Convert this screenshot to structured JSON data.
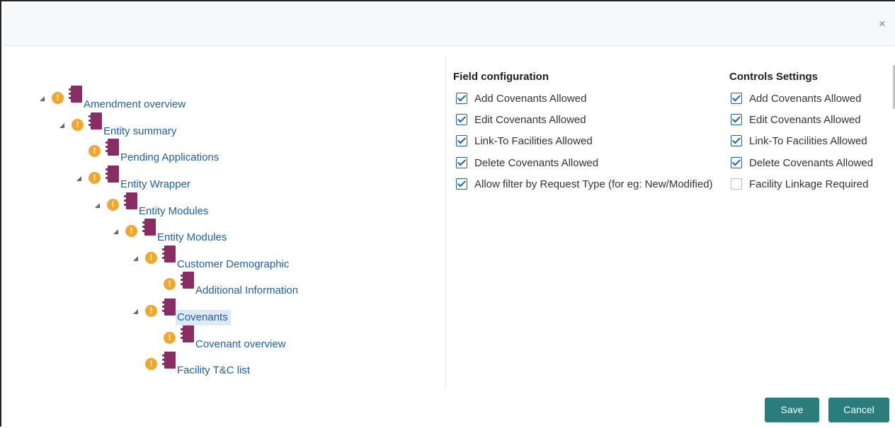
{
  "header": {
    "close_label": "×"
  },
  "tree": [
    {
      "label": "Amendment overview",
      "caret": true,
      "selected": false
    },
    {
      "label": "Entity summary",
      "caret": true,
      "selected": false
    },
    {
      "label": "Pending Applications",
      "caret": false,
      "selected": false
    },
    {
      "label": "Entity Wrapper",
      "caret": true,
      "selected": false
    },
    {
      "label": "Entity Modules",
      "caret": true,
      "selected": false
    },
    {
      "label": "Entity Modules",
      "caret": true,
      "selected": false
    },
    {
      "label": "Customer Demographic",
      "caret": true,
      "selected": false
    },
    {
      "label": "Additional Information",
      "caret": false,
      "selected": false
    },
    {
      "label": "Covenants",
      "caret": true,
      "selected": true
    },
    {
      "label": "Covenant overview",
      "caret": false,
      "selected": false
    },
    {
      "label": "Facility T&C list",
      "caret": false,
      "selected": false
    }
  ],
  "field_configuration": {
    "title": "Field configuration",
    "items": [
      {
        "label": "Add Covenants Allowed",
        "checked": true
      },
      {
        "label": "Edit Covenants Allowed",
        "checked": true
      },
      {
        "label": "Link-To Facilities Allowed",
        "checked": true
      },
      {
        "label": "Delete Covenants Allowed",
        "checked": true
      },
      {
        "label": "Allow filter by Request Type (for eg: New/Modified)",
        "checked": true
      }
    ]
  },
  "controls_settings": {
    "title": "Controls Settings",
    "items": [
      {
        "label": "Add Covenants Allowed",
        "checked": true
      },
      {
        "label": "Edit Covenants Allowed",
        "checked": true
      },
      {
        "label": "Link-To Facilities Allowed",
        "checked": true
      },
      {
        "label": "Delete Covenants Allowed",
        "checked": true
      },
      {
        "label": "Facility Linkage Required",
        "checked": false
      }
    ]
  },
  "footer": {
    "save_label": "Save",
    "cancel_label": "Cancel"
  },
  "colors": {
    "accent_button": "#2a7d7b",
    "link": "#1f5f9f",
    "book_icon": "#8a2c64",
    "alert_icon": "#f0a72d",
    "selected_bg": "#dde9f5"
  }
}
